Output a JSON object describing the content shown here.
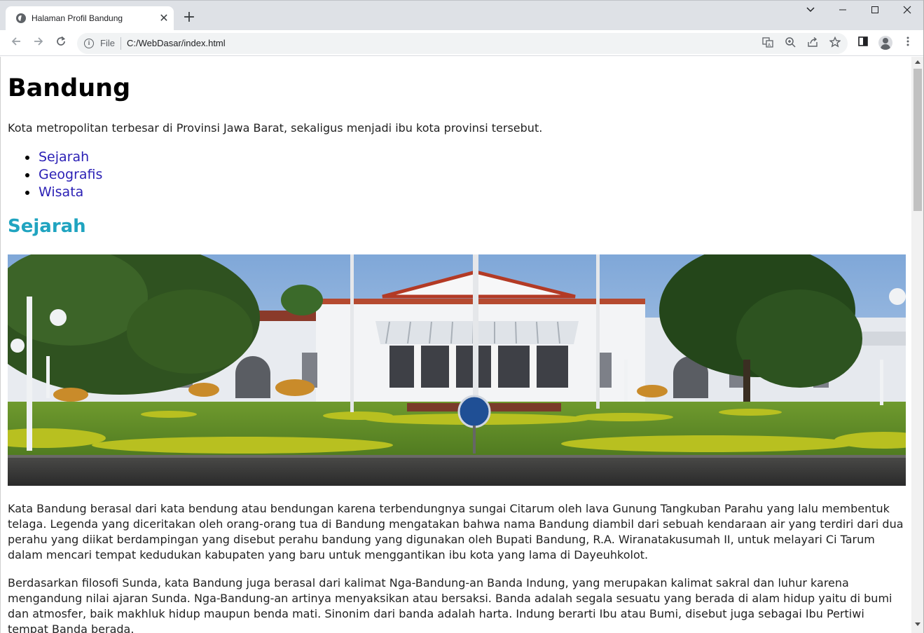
{
  "browser": {
    "tab": {
      "title": "Halaman Profil Bandung",
      "close_glyph": "✕",
      "icon": "globe-icon"
    },
    "new_tab_glyph": "+",
    "window_controls": {
      "dropdown": "⌄",
      "minimize": "—",
      "maximize": "☐",
      "close": "✕"
    },
    "nav": {
      "back": "←",
      "forward": "→",
      "reload": "↻"
    },
    "address": {
      "scheme_label": "File",
      "url": "C:/WebDasar/index.html",
      "info_glyph": "i"
    },
    "toolbar_icons": [
      "translate-icon",
      "zoom-icon",
      "share-icon",
      "star-icon",
      "side-panel-icon",
      "profile-icon",
      "more-icon"
    ]
  },
  "page": {
    "title": "Bandung",
    "intro": "Kota metropolitan terbesar di Provinsi Jawa Barat, sekaligus menjadi ibu kota provinsi tersebut.",
    "nav_links": [
      {
        "label": "Sejarah"
      },
      {
        "label": "Geografis"
      },
      {
        "label": "Wisata"
      }
    ],
    "section_title": "Sejarah",
    "paragraphs": [
      "Kata Bandung berasal dari kata bendung atau bendungan karena terbendungnya sungai Citarum oleh lava Gunung Tangkuban Parahu yang lalu membentuk telaga. Legenda yang diceritakan oleh orang-orang tua di Bandung mengatakan bahwa nama Bandung diambil dari sebuah kendaraan air yang terdiri dari dua perahu yang diikat berdampingan yang disebut perahu bandung yang digunakan oleh Bupati Bandung, R.A. Wiranatakusumah II, untuk melayari Ci Tarum dalam mencari tempat kedudukan kabupaten yang baru untuk menggantikan ibu kota yang lama di Dayeuhkolot.",
      "Berdasarkan filosofi Sunda, kata Bandung juga berasal dari kalimat Nga-Bandung-an Banda Indung, yang merupakan kalimat sakral dan luhur karena mengandung nilai ajaran Sunda. Nga-Bandung-an artinya menyaksikan atau bersaksi. Banda adalah segala sesuatu yang berada di alam hidup yaitu di bumi dan atmosfer, baik makhluk hidup maupun benda mati. Sinonim dari banda adalah harta. Indung berarti Ibu atau Bumi, disebut juga sebagai Ibu Pertiwi tempat Banda berada."
    ]
  },
  "colors": {
    "link": "#2a1fb5",
    "section_heading": "#20a4c0",
    "chrome_bg": "#dee1e6",
    "omnibox_bg": "#f1f3f4"
  }
}
